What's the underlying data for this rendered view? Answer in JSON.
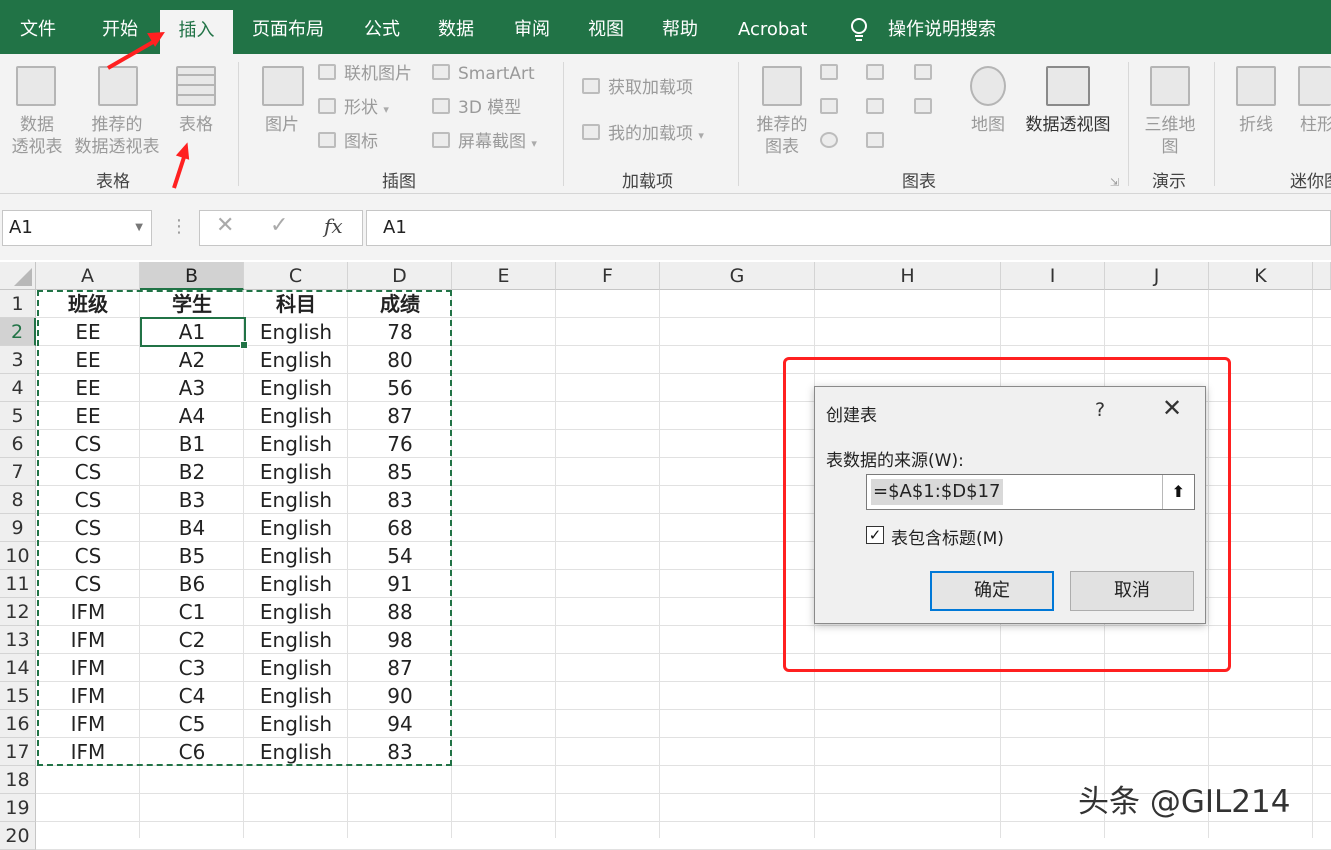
{
  "tabs": [
    "文件",
    "开始",
    "插入",
    "页面布局",
    "公式",
    "数据",
    "审阅",
    "视图",
    "帮助",
    "Acrobat"
  ],
  "active_tab": "插入",
  "tell_me": "操作说明搜索",
  "ribbon": {
    "tables_group": {
      "label": "表格",
      "pivot": "数据\n透视表",
      "recommended_pivot": "推荐的\n数据透视表",
      "table": "表格"
    },
    "illustrations_group": {
      "label": "插图",
      "pictures": "图片",
      "online_pictures": "联机图片",
      "shapes": "形状",
      "icons": "图标",
      "smartart": "SmartArt",
      "model3d": "3D 模型",
      "screenshot": "屏幕截图"
    },
    "addins_group": {
      "label": "加载项",
      "get_addins": "获取加载项",
      "my_addins": "我的加载项"
    },
    "charts_group": {
      "label": "图表",
      "recommended_charts": "推荐的\n图表",
      "maps": "地图",
      "pivot_chart": "数据透视图"
    },
    "tours_group": {
      "label": "演示",
      "map3d": "三维地\n图"
    },
    "sparklines_group": {
      "label": "迷你图",
      "line": "折线",
      "column": "柱形"
    }
  },
  "formula_bar": {
    "name_box": "A1",
    "fx": "fx",
    "formula": "A1"
  },
  "columns": [
    "A",
    "B",
    "C",
    "D",
    "E",
    "F",
    "G",
    "H",
    "I",
    "J",
    "K"
  ],
  "rows": [
    "1",
    "2",
    "3",
    "4",
    "5",
    "6",
    "7",
    "8",
    "9",
    "10",
    "11",
    "12",
    "13",
    "14",
    "15",
    "16",
    "17",
    "18",
    "19",
    "20"
  ],
  "table": {
    "headers": [
      "班级",
      "学生",
      "科目",
      "成绩"
    ],
    "rows": [
      [
        "EE",
        "A1",
        "English",
        "78"
      ],
      [
        "EE",
        "A2",
        "English",
        "80"
      ],
      [
        "EE",
        "A3",
        "English",
        "56"
      ],
      [
        "EE",
        "A4",
        "English",
        "87"
      ],
      [
        "CS",
        "B1",
        "English",
        "76"
      ],
      [
        "CS",
        "B2",
        "English",
        "85"
      ],
      [
        "CS",
        "B3",
        "English",
        "83"
      ],
      [
        "CS",
        "B4",
        "English",
        "68"
      ],
      [
        "CS",
        "B5",
        "English",
        "54"
      ],
      [
        "CS",
        "B6",
        "English",
        "91"
      ],
      [
        "IFM",
        "C1",
        "English",
        "88"
      ],
      [
        "IFM",
        "C2",
        "English",
        "98"
      ],
      [
        "IFM",
        "C3",
        "English",
        "87"
      ],
      [
        "IFM",
        "C4",
        "English",
        "90"
      ],
      [
        "IFM",
        "C5",
        "English",
        "94"
      ],
      [
        "IFM",
        "C6",
        "English",
        "83"
      ]
    ]
  },
  "dialog": {
    "title": "创建表",
    "help": "?",
    "close": "✕",
    "source_label": "表数据的来源(W):",
    "range": "=$A$1:$D$17",
    "has_headers_label": "表包含标题(M)",
    "has_headers_checked": true,
    "ok": "确定",
    "cancel": "取消"
  },
  "watermark": "头条 @GIL214",
  "colors": {
    "excel_green": "#217346",
    "annotation_red": "#ff2020"
  }
}
